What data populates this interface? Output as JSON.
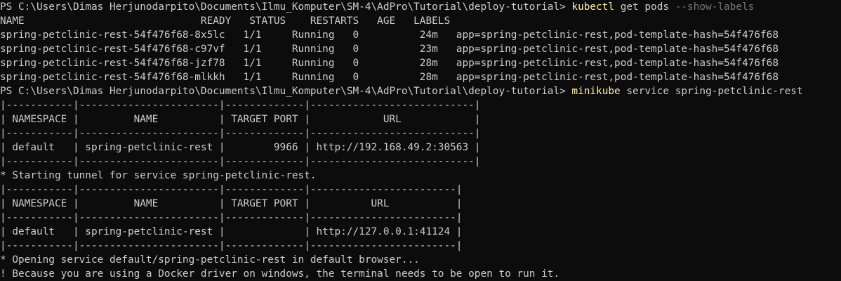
{
  "prompt1": {
    "prefix": "PS C:\\Users\\Dimas Herjunodarpito\\Documents\\Ilmu_Komputer\\SM-4\\AdPro\\Tutorial\\deploy-tutorial> ",
    "cmd": "kubectl",
    "args": " get pods ",
    "flag": "--show-labels"
  },
  "pods": {
    "header": "NAME                             READY   STATUS    RESTARTS   AGE   LABELS",
    "rows": [
      "spring-petclinic-rest-54f476f68-8x5lc   1/1     Running   0          24m   app=spring-petclinic-rest,pod-template-hash=54f476f68",
      "spring-petclinic-rest-54f476f68-c97vf   1/1     Running   0          23m   app=spring-petclinic-rest,pod-template-hash=54f476f68",
      "spring-petclinic-rest-54f476f68-jzf78   1/1     Running   0          28m   app=spring-petclinic-rest,pod-template-hash=54f476f68",
      "spring-petclinic-rest-54f476f68-mlkkh   1/1     Running   0          28m   app=spring-petclinic-rest,pod-template-hash=54f476f68"
    ]
  },
  "prompt2": {
    "prefix": "PS C:\\Users\\Dimas Herjunodarpito\\Documents\\Ilmu_Komputer\\SM-4\\AdPro\\Tutorial\\deploy-tutorial> ",
    "cmd": "minikube",
    "args": " service spring-petclinic-rest"
  },
  "table1": [
    "|-----------|-----------------------|-------------|---------------------------|",
    "| NAMESPACE |         NAME          | TARGET PORT |            URL            |",
    "|-----------|-----------------------|-------------|---------------------------|",
    "| default   | spring-petclinic-rest |        9966 | http://192.168.49.2:30563 |",
    "|-----------|-----------------------|-------------|---------------------------|"
  ],
  "tunnel_msg": "* Starting tunnel for service spring-petclinic-rest.",
  "table2": [
    "|-----------|-----------------------|-------------|------------------------|",
    "| NAMESPACE |         NAME          | TARGET PORT |          URL           |",
    "|-----------|-----------------------|-------------|------------------------|",
    "| default   | spring-petclinic-rest |             | http://127.0.0.1:41124 |",
    "|-----------|-----------------------|-------------|------------------------|"
  ],
  "open_msg": "* Opening service default/spring-petclinic-rest in default browser...",
  "warn_msg": "! Because you are using a Docker driver on windows, the terminal needs to be open to run it."
}
